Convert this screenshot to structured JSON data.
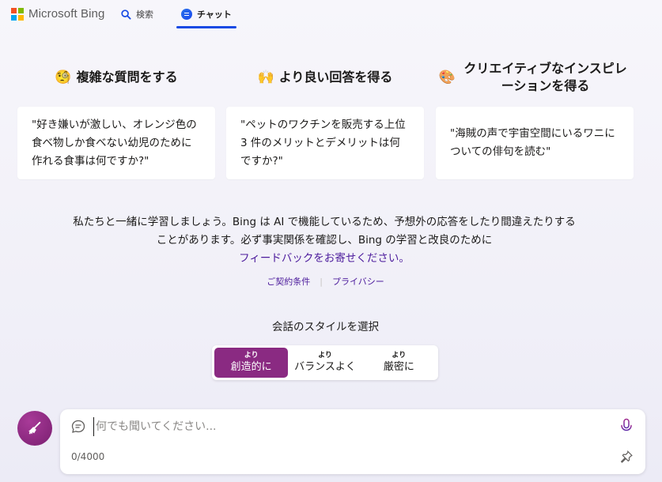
{
  "header": {
    "logo_text": "Microsoft Bing",
    "logo_colors": [
      "#f25022",
      "#7fba00",
      "#00a4ef",
      "#ffb900"
    ],
    "tabs": [
      {
        "label": "検索",
        "icon": "search-icon"
      },
      {
        "label": "チャット",
        "icon": "chat-icon",
        "active": true
      }
    ]
  },
  "features": [
    {
      "emoji": "🧐",
      "title": "複雑な質問をする",
      "example": "\"好き嫌いが激しい、オレンジ色の食べ物しか食べない幼児のために作れる食事は何ですか?\""
    },
    {
      "emoji": "🙌",
      "title": "より良い回答を得る",
      "example": "\"ペットのワクチンを販売する上位 3 件のメリットとデメリットは何ですか?\""
    },
    {
      "emoji": "🎨",
      "title": "クリエイティブなインスピレーションを得る",
      "example": "\"海賊の声で宇宙空間にいるワニについての俳句を読む\""
    }
  ],
  "disclaimer": {
    "text": "私たちと一緒に学習しましょう。Bing は AI で機能しているため、予想外の応答をしたり間違えたりすることがあります。必ず事実関係を確認し、Bing の学習と改良のために",
    "link": "フィードバックをお寄せください。"
  },
  "legal": {
    "terms": "ご契約条件",
    "separator": "|",
    "privacy": "プライバシー"
  },
  "style_selector": {
    "label": "会話のスタイルを選択",
    "options": [
      {
        "small": "より",
        "big": "創造的に",
        "active": true
      },
      {
        "small": "より",
        "big": "バランスよく",
        "active": false
      },
      {
        "small": "より",
        "big": "厳密に",
        "active": false
      }
    ],
    "active_color": "#8a2a82"
  },
  "input": {
    "placeholder": "何でも聞いてください...",
    "value": "",
    "counter": "0/4000"
  },
  "colors": {
    "accent": "#174ae4",
    "link": "#4c1b9c",
    "broom_button": "#8a2a82"
  }
}
